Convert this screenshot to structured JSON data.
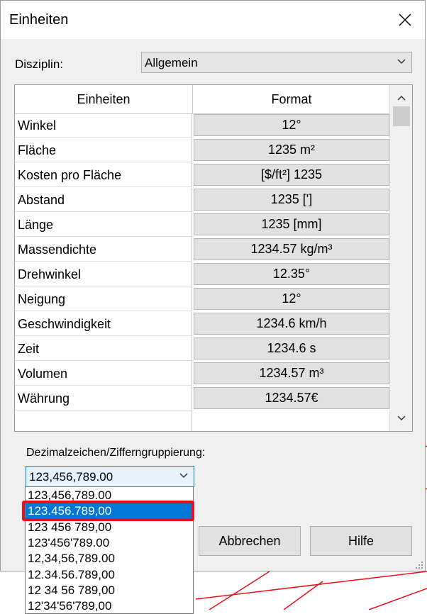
{
  "dialog": {
    "title": "Einheiten",
    "close_glyph": "✕"
  },
  "discipline": {
    "label": "Disziplin:",
    "value": "Allgemein"
  },
  "table": {
    "headers": [
      "Einheiten",
      "Format"
    ],
    "rows": [
      {
        "unit": "Winkel",
        "format": "12°"
      },
      {
        "unit": "Fläche",
        "format": "1235 m²"
      },
      {
        "unit": "Kosten pro Fläche",
        "format": "[$/ft²] 1235"
      },
      {
        "unit": "Abstand",
        "format": "1235 [']"
      },
      {
        "unit": "Länge",
        "format": "1235 [mm]"
      },
      {
        "unit": "Massendichte",
        "format": "1234.57 kg/m³"
      },
      {
        "unit": "Drehwinkel",
        "format": "12.35°"
      },
      {
        "unit": "Neigung",
        "format": "12°"
      },
      {
        "unit": "Geschwindigkeit",
        "format": "1234.6 km/h"
      },
      {
        "unit": "Zeit",
        "format": "1234.6 s"
      },
      {
        "unit": "Volumen",
        "format": "1234.57 m³"
      },
      {
        "unit": "Währung",
        "format": "1234.57€"
      }
    ]
  },
  "decimal": {
    "label": "Dezimalzeichen/Zifferngruppierung:",
    "value": "123,456,789.00",
    "options": [
      "123,456,789.00",
      "123.456.789,00",
      "123 456 789,00",
      "123'456'789.00",
      "12,34,56,789.00",
      "12.34.56.789,00",
      "12 34 56 789,00",
      "12'34'56'789,00"
    ],
    "selected_index": 1
  },
  "buttons": {
    "cancel": "Abbrechen",
    "help": "Hilfe"
  },
  "colors": {
    "selection": "#0078d7",
    "highlight": "#e8101a",
    "dialog_bg": "#f0f0f0"
  },
  "icons": {
    "close": "close-icon",
    "combo_arrow": "chevron-down-icon",
    "scroll_up": "chevron-up-icon",
    "scroll_down": "chevron-down-icon",
    "resize": "resize-grip-icon"
  }
}
